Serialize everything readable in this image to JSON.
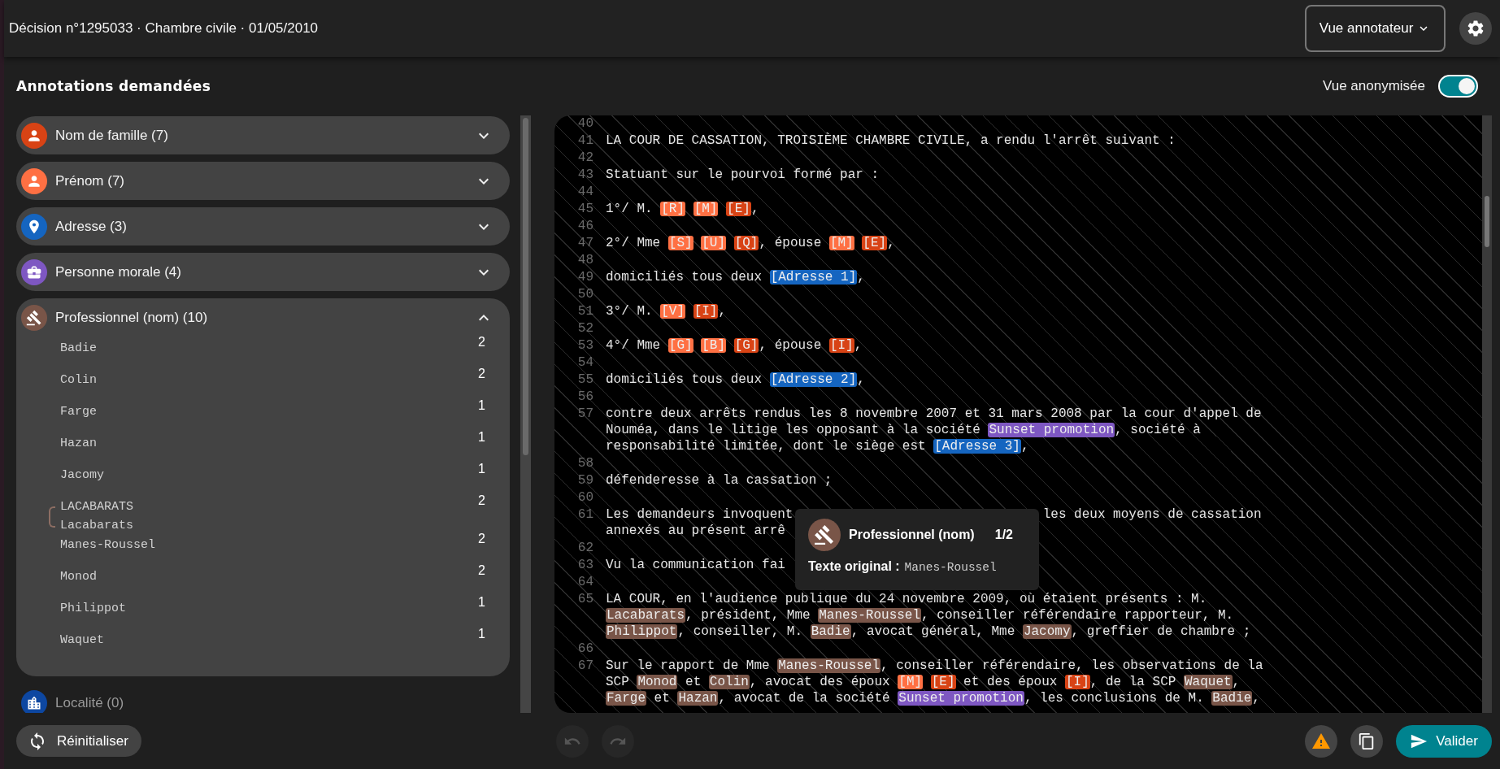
{
  "header": {
    "title": "Décision n°1295033 · Chambre civile · 01/05/2010",
    "view_menu": "Vue annotateur"
  },
  "sidebar": {
    "title": "Annotations demandées",
    "categories": [
      {
        "label": "Nom de famille (7)",
        "kind": "person",
        "color": "#d84315",
        "expanded": false
      },
      {
        "label": "Prénom (7)",
        "kind": "person",
        "color": "#ff7043",
        "expanded": false
      },
      {
        "label": "Adresse (3)",
        "kind": "place",
        "color": "#1565c0",
        "expanded": false
      },
      {
        "label": "Personne morale (4)",
        "kind": "organization",
        "color": "#7e57c2",
        "expanded": false
      },
      {
        "label": "Professionnel (nom) (10)",
        "kind": "profession",
        "color": "#795548",
        "expanded": true,
        "entries": [
          {
            "names": [
              "Badie"
            ],
            "count": "2"
          },
          {
            "names": [
              "Colin"
            ],
            "count": "2"
          },
          {
            "names": [
              "Farge"
            ],
            "count": "1"
          },
          {
            "names": [
              "Hazan"
            ],
            "count": "1"
          },
          {
            "names": [
              "Jacomy"
            ],
            "count": "1"
          },
          {
            "names": [
              "LACABARATS",
              "Lacabarats"
            ],
            "count": "2"
          },
          {
            "names": [
              "Manes-Roussel"
            ],
            "count": "2"
          },
          {
            "names": [
              "Monod"
            ],
            "count": "2"
          },
          {
            "names": [
              "Philippot"
            ],
            "count": "1"
          },
          {
            "names": [
              "Waquet"
            ],
            "count": "1"
          }
        ]
      },
      {
        "label": "Localité (0)",
        "kind": "city",
        "color": "#0d47a1",
        "expanded": false
      }
    ]
  },
  "anonymized_view": {
    "label": "Vue anonymisée",
    "on": true
  },
  "document": {
    "lines": [
      {
        "n": "40"
      },
      {
        "n": "41",
        "rows": [
          {
            "segments": [
              {
                "kind": "text",
                "text": "LA COUR DE CASSATION, TROISIÈME CHAMBRE CIVILE, a rendu l'arrêt suivant :"
              }
            ]
          }
        ]
      },
      {
        "n": "42"
      },
      {
        "n": "43",
        "rows": [
          {
            "segments": [
              {
                "kind": "text",
                "text": "Statuant sur le pourvoi formé par :"
              }
            ]
          }
        ]
      },
      {
        "n": "44"
      },
      {
        "n": "45",
        "rows": [
          {
            "segments": [
              {
                "kind": "text",
                "text": "1°/ M. "
              },
              {
                "kind": "tag",
                "text": "[R]",
                "color": "#ff7043"
              },
              {
                "kind": "tag",
                "text": "[M]",
                "color": "#ff7043"
              },
              {
                "kind": "tag",
                "text": "[E]",
                "color": "#d84315"
              },
              {
                "kind": "text",
                "text": ","
              }
            ]
          }
        ]
      },
      {
        "n": "46"
      },
      {
        "n": "47",
        "rows": [
          {
            "segments": [
              {
                "kind": "text",
                "text": "2°/ Mme "
              },
              {
                "kind": "tag",
                "text": "[S]",
                "color": "#ff7043"
              },
              {
                "kind": "tag",
                "text": "[U]",
                "color": "#ff7043"
              },
              {
                "kind": "tag",
                "text": "[Q]",
                "color": "#d84315"
              },
              {
                "kind": "text",
                "text": ", épouse "
              },
              {
                "kind": "tag",
                "text": "[M]",
                "color": "#ff7043"
              },
              {
                "kind": "tag",
                "text": "[E]",
                "color": "#d84315"
              },
              {
                "kind": "text",
                "text": ","
              }
            ]
          }
        ]
      },
      {
        "n": "48"
      },
      {
        "n": "49",
        "rows": [
          {
            "segments": [
              {
                "kind": "text",
                "text": "domiciliés tous deux "
              },
              {
                "kind": "tag",
                "text": "[Adresse 1]",
                "color": "#1565c0"
              },
              {
                "kind": "text",
                "text": ","
              }
            ]
          }
        ]
      },
      {
        "n": "50"
      },
      {
        "n": "51",
        "rows": [
          {
            "segments": [
              {
                "kind": "text",
                "text": "3°/ M. "
              },
              {
                "kind": "tag",
                "text": "[V]",
                "color": "#ff7043"
              },
              {
                "kind": "tag",
                "text": "[I]",
                "color": "#d84315"
              },
              {
                "kind": "text",
                "text": ","
              }
            ]
          }
        ]
      },
      {
        "n": "52"
      },
      {
        "n": "53",
        "rows": [
          {
            "segments": [
              {
                "kind": "text",
                "text": "4°/ Mme "
              },
              {
                "kind": "tag",
                "text": "[G]",
                "color": "#ff7043"
              },
              {
                "kind": "tag",
                "text": "[B]",
                "color": "#ff7043"
              },
              {
                "kind": "tag",
                "text": "[G]",
                "color": "#d84315"
              },
              {
                "kind": "text",
                "text": ", épouse "
              },
              {
                "kind": "tag",
                "text": "[I]",
                "color": "#d84315"
              },
              {
                "kind": "text",
                "text": ","
              }
            ]
          }
        ]
      },
      {
        "n": "54"
      },
      {
        "n": "55",
        "rows": [
          {
            "segments": [
              {
                "kind": "text",
                "text": "domiciliés tous deux "
              },
              {
                "kind": "tag",
                "text": "[Adresse 2]",
                "color": "#1565c0"
              },
              {
                "kind": "text",
                "text": ","
              }
            ]
          }
        ]
      },
      {
        "n": "56"
      },
      {
        "n": "57",
        "rows": [
          {
            "segments": [
              {
                "kind": "text",
                "text": "contre deux arrêts rendus les 8 novembre 2007 et 31 mars 2008 par la cour d'appel de"
              }
            ]
          },
          {
            "segments": [
              {
                "kind": "text",
                "text": "Nouméa, dans le litige les opposant à la société "
              },
              {
                "kind": "tag",
                "text": "Sunset promotion",
                "color": "#7e57c2"
              },
              {
                "kind": "text",
                "text": ", société à"
              }
            ]
          },
          {
            "segments": [
              {
                "kind": "text",
                "text": "responsabilité limitée, dont le siège est "
              },
              {
                "kind": "tag",
                "text": "[Adresse 3]",
                "color": "#1565c0"
              },
              {
                "kind": "text",
                "text": ","
              }
            ]
          }
        ]
      },
      {
        "n": "58"
      },
      {
        "n": "59",
        "rows": [
          {
            "segments": [
              {
                "kind": "text",
                "text": "défenderesse à la cassation ;"
              }
            ]
          }
        ]
      },
      {
        "n": "60"
      },
      {
        "n": "61",
        "rows": [
          {
            "segments": [
              {
                "kind": "text",
                "text": "Les demandeurs invoquent"
              },
              {
                "kind": "gap"
              },
              {
                "kind": "text",
                "text": "les deux moyens de cassation"
              }
            ]
          },
          {
            "segments": [
              {
                "kind": "text",
                "text": "annexés au présent arrê"
              }
            ]
          }
        ]
      },
      {
        "n": "62"
      },
      {
        "n": "63",
        "rows": [
          {
            "segments": [
              {
                "kind": "text",
                "text": "Vu la communication fai"
              }
            ]
          }
        ]
      },
      {
        "n": "64"
      },
      {
        "n": "65",
        "rows": [
          {
            "segments": [
              {
                "kind": "text",
                "text": "LA COUR, en l'audience publique du 24 novembre 2009, où étaient présents : M."
              }
            ]
          },
          {
            "segments": [
              {
                "kind": "tag",
                "text": "Lacabarats",
                "color": "#795548"
              },
              {
                "kind": "text",
                "text": ", président, Mme "
              },
              {
                "kind": "tag",
                "text": "Manes-Roussel",
                "color": "#795548"
              },
              {
                "kind": "text",
                "text": ", conseiller référendaire rapporteur, M."
              }
            ]
          },
          {
            "segments": [
              {
                "kind": "tag",
                "text": "Philippot",
                "color": "#795548"
              },
              {
                "kind": "text",
                "text": ", conseiller, M. "
              },
              {
                "kind": "tag",
                "text": "Badie",
                "color": "#795548"
              },
              {
                "kind": "text",
                "text": ", avocat général, Mme "
              },
              {
                "kind": "tag",
                "text": "Jacomy",
                "color": "#795548"
              },
              {
                "kind": "text",
                "text": ", greffier de chambre ;"
              }
            ]
          }
        ]
      },
      {
        "n": "66"
      },
      {
        "n": "67",
        "rows": [
          {
            "segments": [
              {
                "kind": "text",
                "text": "Sur le rapport de Mme "
              },
              {
                "kind": "tag",
                "text": "Manes-Roussel",
                "color": "#795548"
              },
              {
                "kind": "text",
                "text": ", conseiller référendaire, les observations de la"
              }
            ]
          },
          {
            "segments": [
              {
                "kind": "text",
                "text": "SCP "
              },
              {
                "kind": "tag",
                "text": "Monod",
                "color": "#795548"
              },
              {
                "kind": "text",
                "text": " et "
              },
              {
                "kind": "tag",
                "text": "Colin",
                "color": "#795548"
              },
              {
                "kind": "text",
                "text": ", avocat des époux "
              },
              {
                "kind": "tag",
                "text": "[M]",
                "color": "#ff7043"
              },
              {
                "kind": "tag",
                "text": "[E]",
                "color": "#d84315"
              },
              {
                "kind": "text",
                "text": " et des époux "
              },
              {
                "kind": "tag",
                "text": "[I]",
                "color": "#d84315"
              },
              {
                "kind": "text",
                "text": ", de la SCP "
              },
              {
                "kind": "tag",
                "text": "Waquet",
                "color": "#795548"
              },
              {
                "kind": "text",
                "text": ","
              }
            ]
          },
          {
            "segments": [
              {
                "kind": "tag",
                "text": "Farge",
                "color": "#795548"
              },
              {
                "kind": "text",
                "text": " et "
              },
              {
                "kind": "tag",
                "text": "Hazan",
                "color": "#795548"
              },
              {
                "kind": "text",
                "text": ", avocat de la société "
              },
              {
                "kind": "tag",
                "text": "Sunset promotion",
                "color": "#7e57c2"
              },
              {
                "kind": "text",
                "text": ", les conclusions de M. "
              },
              {
                "kind": "tag",
                "text": "Badie",
                "color": "#795548"
              },
              {
                "kind": "text",
                "text": ","
              }
            ]
          }
        ]
      }
    ]
  },
  "tooltip": {
    "category": "Professionnel (nom)",
    "kind": "profession",
    "color": "#795548",
    "position": "1/2",
    "label": "Texte original :",
    "value": "Manes-Roussel"
  },
  "footer": {
    "reset": "Réinitialiser",
    "undo": {
      "disabled": true
    },
    "redo": {
      "disabled": true
    },
    "validate": "Valider"
  }
}
